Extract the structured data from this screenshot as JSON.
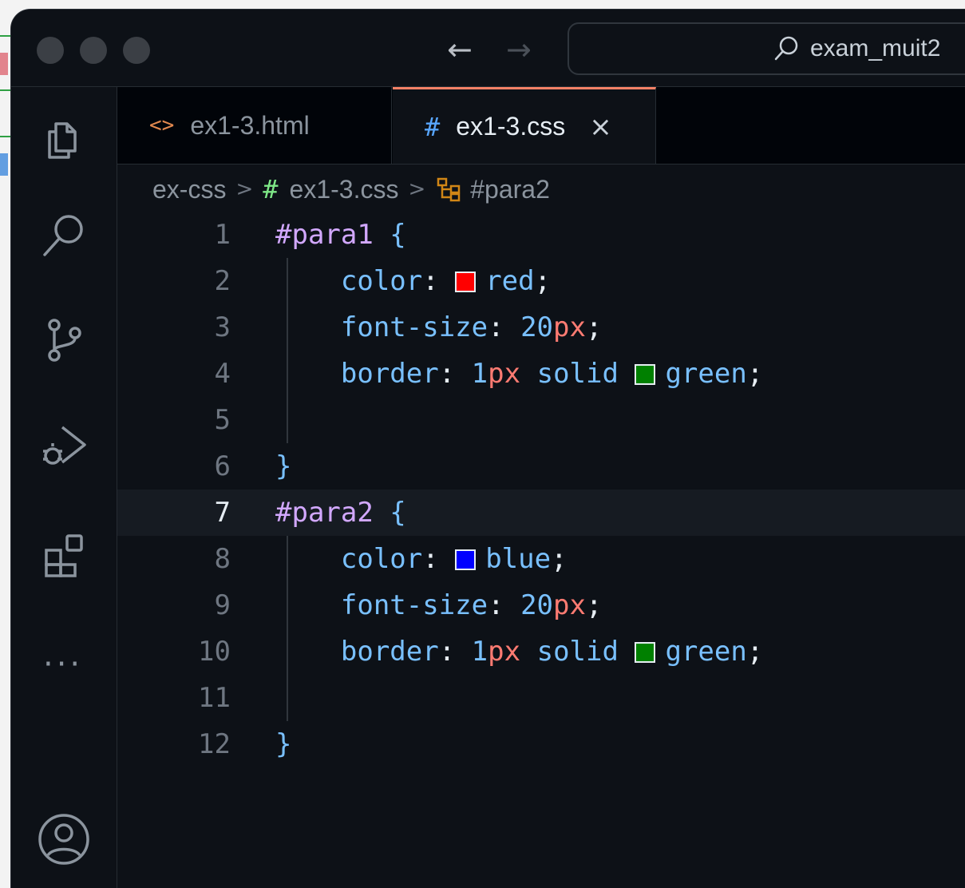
{
  "window": {
    "nav_back": "←",
    "nav_forward": "→",
    "search_text": "exam_muit2"
  },
  "tabs": [
    {
      "icon": "<>",
      "label": "ex1-3.html",
      "active": false
    },
    {
      "icon": "#",
      "label": "ex1-3.css",
      "active": true,
      "close": "×"
    }
  ],
  "breadcrumb": {
    "folder": "ex-css",
    "file_icon": "#",
    "file": "ex1-3.css",
    "symbol": "#para2"
  },
  "activity_bar": [
    "explorer-icon",
    "search-icon",
    "source-control-icon",
    "run-debug-icon",
    "extensions-icon",
    "more-icon",
    "account-icon"
  ],
  "colors": {
    "red": "#ff0000",
    "green": "#008000",
    "blue": "#0000ff",
    "accent": "#f78166"
  },
  "current_line": 7,
  "code": {
    "lines": [
      {
        "n": "1",
        "selector": "#para1",
        "brace": " {"
      },
      {
        "n": "2",
        "indent": "    ",
        "prop": "color",
        "value": "red"
      },
      {
        "n": "3",
        "indent": "    ",
        "prop": "font-size",
        "num": "20",
        "unit": "px"
      },
      {
        "n": "4",
        "indent": "    ",
        "prop": "border",
        "num": "1",
        "unit": "px",
        "word": "solid",
        "value": "green"
      },
      {
        "n": "5"
      },
      {
        "n": "6",
        "close": "}"
      },
      {
        "n": "7",
        "selector": "#para2",
        "brace": " {"
      },
      {
        "n": "8",
        "indent": "    ",
        "prop": "color",
        "value": "blue"
      },
      {
        "n": "9",
        "indent": "    ",
        "prop": "font-size",
        "num": "20",
        "unit": "px"
      },
      {
        "n": "10",
        "indent": "    ",
        "prop": "border",
        "num": "1",
        "unit": "px",
        "word": "solid",
        "value": "green"
      },
      {
        "n": "11"
      },
      {
        "n": "12",
        "close": "}"
      }
    ]
  }
}
